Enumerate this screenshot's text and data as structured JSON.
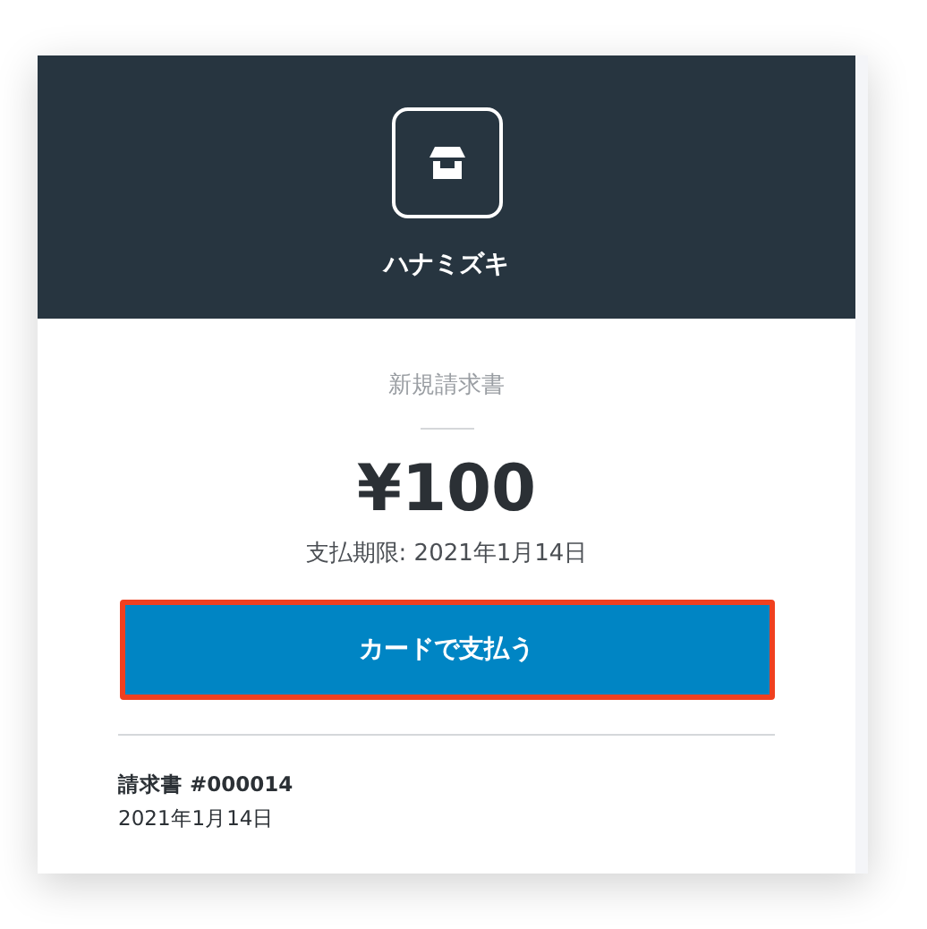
{
  "shop": {
    "name": "ハナミズキ"
  },
  "invoice": {
    "title": "新規請求書",
    "amount": "¥100",
    "due": "支払期限: 2021年1月14日"
  },
  "pay_button": {
    "label": "カードで支払う",
    "highlighted": true
  },
  "details": {
    "number": "請求書 #000014",
    "date": "2021年1月14日"
  }
}
